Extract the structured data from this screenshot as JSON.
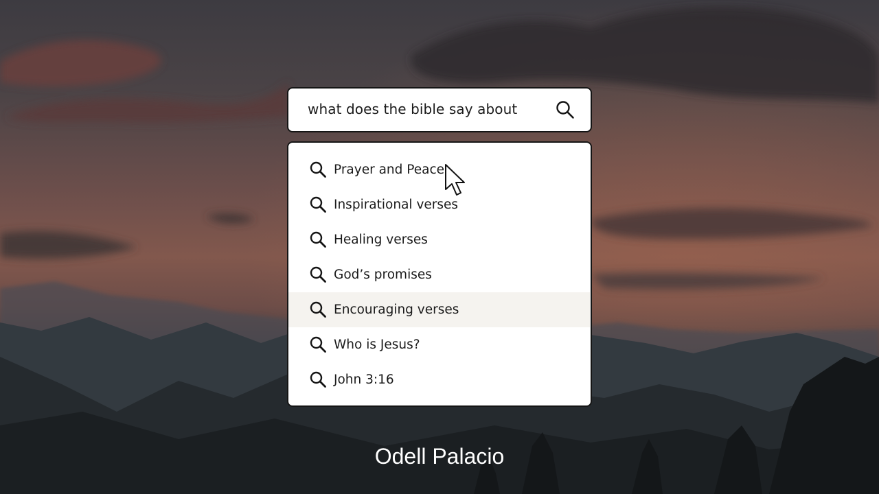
{
  "search": {
    "query": "what does the bible say about",
    "icon": "search-icon"
  },
  "suggestions": [
    {
      "label": "Prayer and Peace",
      "icon": "search-icon",
      "highlighted": false
    },
    {
      "label": "Inspirational verses",
      "icon": "search-icon",
      "highlighted": false
    },
    {
      "label": "Healing verses",
      "icon": "search-icon",
      "highlighted": false
    },
    {
      "label": "God’s promises",
      "icon": "search-icon",
      "highlighted": false
    },
    {
      "label": "Encouraging verses",
      "icon": "search-icon",
      "highlighted": true
    },
    {
      "label": "Who is Jesus?",
      "icon": "search-icon",
      "highlighted": false
    },
    {
      "label": "John 3:16",
      "icon": "search-icon",
      "highlighted": false
    }
  ],
  "footer": {
    "author": "Odell Palacio"
  },
  "colors": {
    "highlight": "#f5f3ef",
    "border": "#151515",
    "text": "#1a1a1a",
    "sky_top": "#3f3d42",
    "sky_glow": "#8a5a4e",
    "mountains": "#2b3236"
  }
}
